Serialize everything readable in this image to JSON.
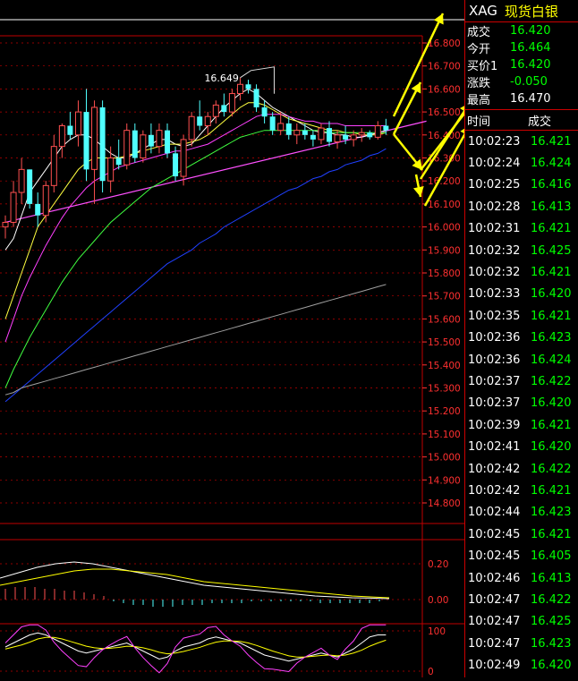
{
  "panel": {
    "symbol": "XAG",
    "name": "现货白银",
    "quote": [
      {
        "label": "成交",
        "value": "16.420"
      },
      {
        "label": "今开",
        "value": "16.464"
      },
      {
        "label": "买价1",
        "value": "16.420"
      },
      {
        "label": "涨跌",
        "value": "-0.050"
      },
      {
        "label": "最高",
        "value": "16.470"
      }
    ],
    "tick_headers": [
      "时间",
      "成交"
    ],
    "ticks": [
      [
        "10:02:23",
        "16.421"
      ],
      [
        "10:02:24",
        "16.424"
      ],
      [
        "10:02:25",
        "16.416"
      ],
      [
        "10:02:28",
        "16.413"
      ],
      [
        "10:02:31",
        "16.421"
      ],
      [
        "10:02:32",
        "16.425"
      ],
      [
        "10:02:32",
        "16.421"
      ],
      [
        "10:02:33",
        "16.420"
      ],
      [
        "10:02:35",
        "16.421"
      ],
      [
        "10:02:36",
        "16.423"
      ],
      [
        "10:02:36",
        "16.424"
      ],
      [
        "10:02:37",
        "16.422"
      ],
      [
        "10:02:37",
        "16.420"
      ],
      [
        "10:02:39",
        "16.421"
      ],
      [
        "10:02:41",
        "16.420"
      ],
      [
        "10:02:42",
        "16.422"
      ],
      [
        "10:02:42",
        "16.421"
      ],
      [
        "10:02:44",
        "16.423"
      ],
      [
        "10:02:45",
        "16.421"
      ],
      [
        "10:02:45",
        "16.405"
      ],
      [
        "10:02:46",
        "16.413"
      ],
      [
        "10:02:47",
        "16.422"
      ],
      [
        "10:02:47",
        "16.425"
      ],
      [
        "10:02:47",
        "16.423"
      ],
      [
        "10:02:49",
        "16.420"
      ]
    ]
  },
  "colors": {
    "up": "#ff5050",
    "down": "#50ffff",
    "grid": "#c00000",
    "axis": "#ff3030",
    "ma_white": "#ffffff",
    "ma_yellow": "#ffff40",
    "ma_magenta": "#ff40ff",
    "ma_green": "#40ff40",
    "ma_blue": "#2040ff",
    "ma_gray": "#a0a0a0",
    "arrow": "#ffff00"
  },
  "chart_data": {
    "type": "candlestick",
    "ylim": [
      14.7,
      16.9
    ],
    "yticks": [
      "16.800",
      "16.700",
      "16.600",
      "16.500",
      "16.400",
      "16.300",
      "16.200",
      "16.100",
      "16.000",
      "15.900",
      "15.800",
      "15.700",
      "15.600",
      "15.500",
      "15.400",
      "15.300",
      "15.200",
      "15.100",
      "15.000",
      "14.900",
      "14.800"
    ],
    "annotation": {
      "text": "16.649",
      "value": 16.649
    },
    "candles": [
      [
        16.0,
        16.05,
        15.95,
        16.02
      ],
      [
        16.02,
        16.2,
        16.0,
        16.15
      ],
      [
        16.15,
        16.3,
        16.1,
        16.25
      ],
      [
        16.25,
        16.25,
        16.08,
        16.1
      ],
      [
        16.1,
        16.15,
        16.0,
        16.05
      ],
      [
        16.05,
        16.2,
        16.02,
        16.18
      ],
      [
        16.18,
        16.4,
        16.15,
        16.35
      ],
      [
        16.35,
        16.45,
        16.3,
        16.44
      ],
      [
        16.44,
        16.5,
        16.38,
        16.4
      ],
      [
        16.4,
        16.55,
        16.35,
        16.5
      ],
      [
        16.5,
        16.6,
        16.2,
        16.25
      ],
      [
        16.25,
        16.55,
        16.1,
        16.52
      ],
      [
        16.52,
        16.55,
        16.15,
        16.2
      ],
      [
        16.2,
        16.35,
        16.15,
        16.3
      ],
      [
        16.3,
        16.38,
        16.25,
        16.27
      ],
      [
        16.27,
        16.45,
        16.25,
        16.42
      ],
      [
        16.42,
        16.45,
        16.28,
        16.3
      ],
      [
        16.3,
        16.42,
        16.28,
        16.4
      ],
      [
        16.4,
        16.45,
        16.32,
        16.35
      ],
      [
        16.35,
        16.45,
        16.32,
        16.42
      ],
      [
        16.42,
        16.45,
        16.3,
        16.32
      ],
      [
        16.32,
        16.35,
        16.2,
        16.22
      ],
      [
        16.22,
        16.4,
        16.18,
        16.38
      ],
      [
        16.38,
        16.5,
        16.35,
        16.48
      ],
      [
        16.48,
        16.55,
        16.42,
        16.44
      ],
      [
        16.44,
        16.5,
        16.4,
        16.48
      ],
      [
        16.48,
        16.55,
        16.45,
        16.53
      ],
      [
        16.53,
        16.58,
        16.48,
        16.5
      ],
      [
        16.5,
        16.6,
        16.48,
        16.58
      ],
      [
        16.58,
        16.649,
        16.55,
        16.62
      ],
      [
        16.62,
        16.64,
        16.58,
        16.6
      ],
      [
        16.6,
        16.62,
        16.5,
        16.52
      ],
      [
        16.52,
        16.55,
        16.45,
        16.48
      ],
      [
        16.48,
        16.5,
        16.4,
        16.42
      ],
      [
        16.42,
        16.5,
        16.4,
        16.45
      ],
      [
        16.45,
        16.48,
        16.38,
        16.4
      ],
      [
        16.4,
        16.45,
        16.36,
        16.42
      ],
      [
        16.42,
        16.45,
        16.38,
        16.4
      ],
      [
        16.4,
        16.42,
        16.35,
        16.38
      ],
      [
        16.38,
        16.45,
        16.36,
        16.43
      ],
      [
        16.43,
        16.46,
        16.35,
        16.37
      ],
      [
        16.37,
        16.42,
        16.34,
        16.4
      ],
      [
        16.4,
        16.44,
        16.36,
        16.38
      ],
      [
        16.38,
        16.42,
        16.35,
        16.4
      ],
      [
        16.4,
        16.43,
        16.37,
        16.41
      ],
      [
        16.41,
        16.42,
        16.38,
        16.39
      ],
      [
        16.39,
        16.46,
        16.38,
        16.44
      ],
      [
        16.44,
        16.47,
        16.4,
        16.42
      ]
    ],
    "ma": [
      {
        "color": "ma_white",
        "values": [
          15.9,
          15.95,
          16.05,
          16.15,
          16.2,
          16.25,
          16.3,
          16.35,
          16.38,
          16.4,
          16.4,
          16.38,
          16.35,
          16.32,
          16.3,
          16.3,
          16.32,
          16.34,
          16.36,
          16.38,
          16.38,
          16.36,
          16.35,
          16.36,
          16.4,
          16.44,
          16.48,
          16.52,
          16.55,
          16.58,
          16.6,
          16.58,
          16.55,
          16.52,
          16.5,
          16.48,
          16.46,
          16.44,
          16.42,
          16.41,
          16.41,
          16.4,
          16.4,
          16.39,
          16.39,
          16.4,
          16.41,
          16.42
        ]
      },
      {
        "color": "ma_yellow",
        "values": [
          15.6,
          15.7,
          15.8,
          15.9,
          16.0,
          16.05,
          16.1,
          16.15,
          16.2,
          16.25,
          16.28,
          16.3,
          16.3,
          16.3,
          16.3,
          16.31,
          16.32,
          16.33,
          16.34,
          16.35,
          16.36,
          16.36,
          16.36,
          16.37,
          16.38,
          16.4,
          16.43,
          16.46,
          16.49,
          16.52,
          16.54,
          16.54,
          16.53,
          16.51,
          16.49,
          16.47,
          16.46,
          16.45,
          16.44,
          16.43,
          16.42,
          16.42,
          16.41,
          16.41,
          16.4,
          16.4,
          16.4,
          16.41
        ]
      },
      {
        "color": "ma_magenta",
        "values": [
          15.5,
          15.6,
          15.7,
          15.78,
          15.85,
          15.92,
          15.98,
          16.04,
          16.09,
          16.13,
          16.17,
          16.2,
          16.22,
          16.24,
          16.26,
          16.27,
          16.28,
          16.29,
          16.3,
          16.31,
          16.32,
          16.33,
          16.33,
          16.34,
          16.35,
          16.36,
          16.38,
          16.4,
          16.42,
          16.44,
          16.46,
          16.48,
          16.49,
          16.49,
          16.49,
          16.48,
          16.47,
          16.46,
          16.46,
          16.45,
          16.45,
          16.45,
          16.44,
          16.44,
          16.44,
          16.44,
          16.44,
          16.44
        ]
      },
      {
        "color": "ma_green",
        "values": [
          15.3,
          15.38,
          15.45,
          15.52,
          15.58,
          15.64,
          15.7,
          15.76,
          15.81,
          15.86,
          15.9,
          15.94,
          15.98,
          16.02,
          16.05,
          16.08,
          16.11,
          16.14,
          16.17,
          16.19,
          16.21,
          16.23,
          16.25,
          16.27,
          16.29,
          16.31,
          16.33,
          16.35,
          16.37,
          16.39,
          16.4,
          16.41,
          16.42,
          16.42,
          16.42,
          16.42,
          16.42,
          16.42,
          16.42,
          16.42,
          16.41,
          16.41,
          16.41,
          16.41,
          16.41,
          16.41,
          16.41,
          16.41
        ]
      },
      {
        "color": "ma_blue",
        "values": [
          15.24,
          15.27,
          15.3,
          15.33,
          15.36,
          15.39,
          15.42,
          15.45,
          15.48,
          15.51,
          15.54,
          15.57,
          15.6,
          15.63,
          15.66,
          15.69,
          15.72,
          15.75,
          15.78,
          15.81,
          15.84,
          15.86,
          15.88,
          15.9,
          15.93,
          15.95,
          15.97,
          16.0,
          16.02,
          16.04,
          16.06,
          16.08,
          16.1,
          16.12,
          16.14,
          16.16,
          16.17,
          16.19,
          16.21,
          16.22,
          16.24,
          16.25,
          16.27,
          16.28,
          16.29,
          16.31,
          16.32,
          16.34
        ]
      },
      {
        "color": "ma_gray",
        "values": [
          15.27,
          15.28,
          15.3,
          15.31,
          15.32,
          15.33,
          15.34,
          15.35,
          15.36,
          15.37,
          15.38,
          15.39,
          15.4,
          15.41,
          15.42,
          15.43,
          15.44,
          15.45,
          15.46,
          15.47,
          15.48,
          15.49,
          15.5,
          15.51,
          15.52,
          15.53,
          15.54,
          15.55,
          15.56,
          15.57,
          15.58,
          15.59,
          15.6,
          15.61,
          15.62,
          15.63,
          15.64,
          15.65,
          15.66,
          15.67,
          15.68,
          15.69,
          15.7,
          15.71,
          15.72,
          15.73,
          15.74,
          15.75
        ]
      }
    ],
    "trendline": [
      {
        "i": 0,
        "v": 16.02
      },
      {
        "i": 52,
        "v": 16.46
      }
    ],
    "macd": {
      "yticks": [
        "0.20",
        "0.00"
      ],
      "ylim": [
        -0.1,
        0.3
      ],
      "dif": [
        0.12,
        0.15,
        0.18,
        0.2,
        0.21,
        0.2,
        0.18,
        0.16,
        0.14,
        0.12,
        0.1,
        0.08,
        0.07,
        0.06,
        0.05,
        0.04,
        0.03,
        0.02,
        0.015,
        0.01,
        0.008,
        0.005
      ],
      "dea": [
        0.08,
        0.1,
        0.12,
        0.14,
        0.16,
        0.17,
        0.17,
        0.16,
        0.15,
        0.14,
        0.12,
        0.1,
        0.09,
        0.08,
        0.07,
        0.06,
        0.05,
        0.04,
        0.03,
        0.02,
        0.015,
        0.01
      ],
      "hist": [
        0.06,
        0.07,
        0.07,
        0.07,
        0.06,
        0.06,
        0.05,
        0.05,
        0.04,
        0.03,
        0.02,
        -0.01,
        -0.02,
        -0.03,
        -0.03,
        -0.04,
        -0.04,
        -0.04,
        -0.03,
        -0.03,
        -0.03,
        -0.02,
        -0.02,
        -0.02,
        -0.02,
        -0.01,
        -0.01,
        -0.01,
        -0.01,
        -0.01,
        -0.01,
        -0.01,
        -0.02,
        -0.02,
        -0.02,
        -0.02,
        -0.02,
        -0.02,
        -0.01
      ]
    },
    "kdj": {
      "yticks": [
        "100",
        "0"
      ],
      "ylim": [
        0,
        100
      ],
      "k": [
        60,
        70,
        80,
        90,
        95,
        90,
        80,
        70,
        60,
        50,
        45,
        50,
        55,
        60,
        65,
        70,
        60,
        50,
        40,
        30,
        35,
        50,
        60,
        65,
        70,
        80,
        85,
        80,
        75,
        70,
        60,
        50,
        40,
        35,
        30,
        25,
        30,
        35,
        40,
        45,
        40,
        35,
        45,
        55,
        70,
        85,
        90,
        90
      ],
      "d": [
        55,
        60,
        65,
        72,
        80,
        84,
        84,
        80,
        74,
        68,
        62,
        58,
        56,
        57,
        59,
        62,
        61,
        58,
        53,
        47,
        43,
        45,
        49,
        54,
        59,
        66,
        72,
        75,
        75,
        74,
        70,
        64,
        57,
        50,
        44,
        38,
        35,
        35,
        37,
        39,
        40,
        38,
        40,
        45,
        52,
        62,
        70,
        77
      ],
      "j": [
        70,
        90,
        110,
        126,
        125,
        102,
        72,
        50,
        32,
        14,
        11,
        34,
        53,
        66,
        77,
        86,
        58,
        34,
        14,
        -4,
        19,
        60,
        82,
        87,
        92,
        108,
        111,
        90,
        75,
        62,
        40,
        22,
        6,
        5,
        2,
        -1,
        20,
        35,
        46,
        57,
        40,
        29,
        55,
        75,
        106,
        131,
        130,
        116
      ]
    }
  }
}
